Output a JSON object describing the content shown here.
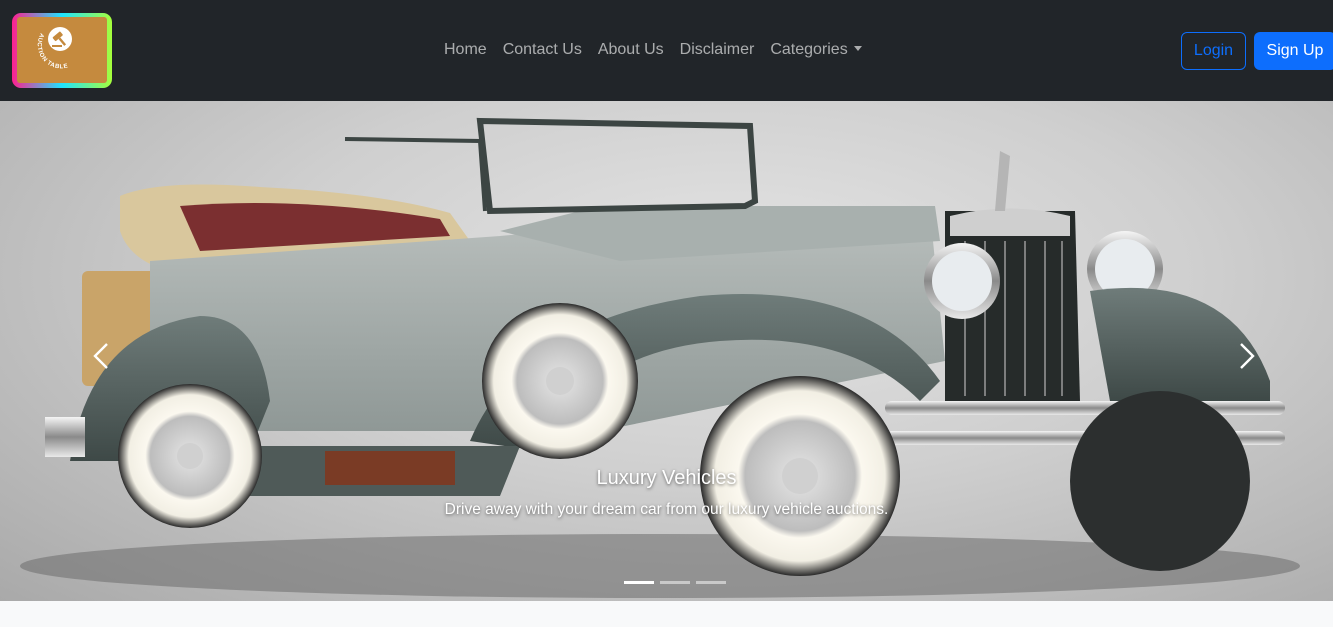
{
  "brand": {
    "logo_text": "AUCTION TABLE"
  },
  "nav": {
    "links": [
      "Home",
      "Contact Us",
      "About Us",
      "Disclaimer"
    ],
    "categories_label": "Categories"
  },
  "auth": {
    "login_label": "Login",
    "signup_label": "Sign Up"
  },
  "carousel": {
    "slide_title": "Luxury Vehicles",
    "slide_text": "Drive away with your dream car from our luxury vehicle auctions.",
    "slides_count": 3,
    "active_index": 0,
    "prev_icon": "chevron-left-icon",
    "next_icon": "chevron-right-icon"
  },
  "colors": {
    "navbar": "#212529",
    "primary": "#0d6efd",
    "logo_bg": "#c58a3e"
  }
}
